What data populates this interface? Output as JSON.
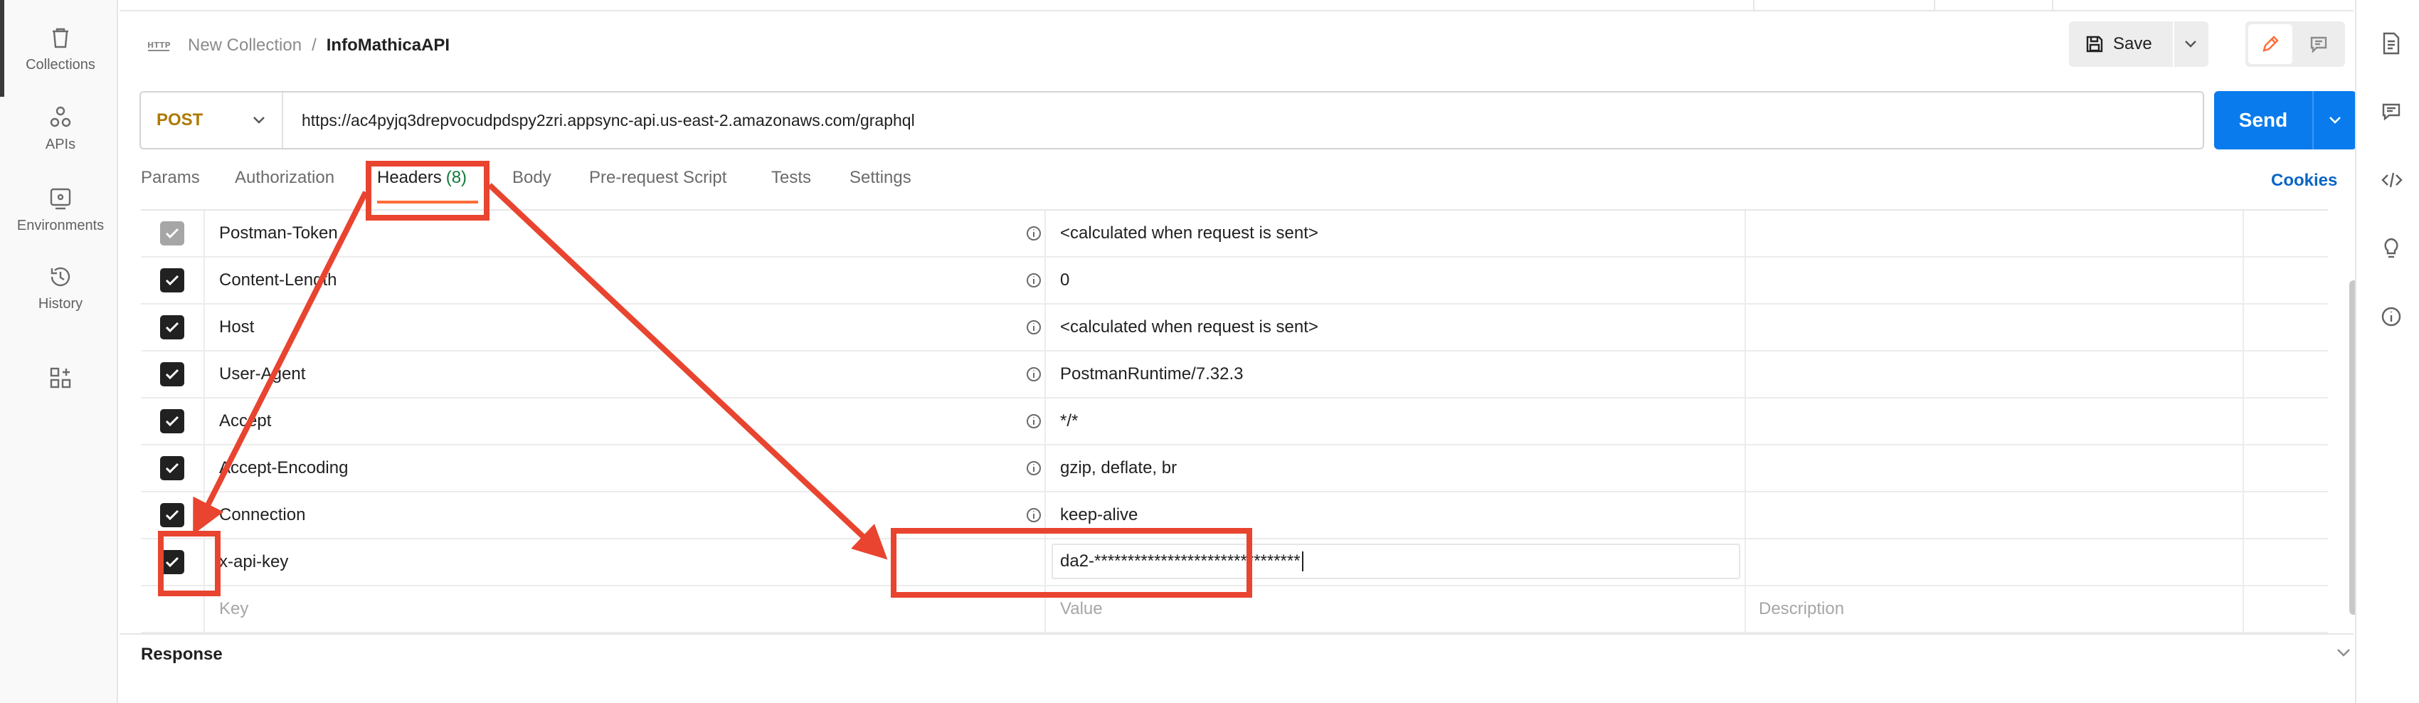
{
  "sidebar": {
    "items": [
      {
        "label": "Collections",
        "icon": "trash-icon"
      },
      {
        "label": "APIs",
        "icon": "apis-icon"
      },
      {
        "label": "Environments",
        "icon": "environments-icon"
      },
      {
        "label": "History",
        "icon": "history-icon"
      },
      {
        "label": "",
        "icon": "add-workspace-icon"
      }
    ]
  },
  "breadcrumb": {
    "icon": "http-icon",
    "collection": "New Collection",
    "separator": "/",
    "request": "InfoMathicaAPI"
  },
  "toolbar": {
    "save_label": "Save"
  },
  "request": {
    "method": "POST",
    "url": "https://ac4pyjq3drepvocudpdspy2zri.appsync-api.us-east-2.amazonaws.com/graphql",
    "send_label": "Send"
  },
  "tabs": [
    {
      "label": "Params"
    },
    {
      "label": "Authorization"
    },
    {
      "label": "Headers",
      "count": "(8)",
      "active": true
    },
    {
      "label": "Body"
    },
    {
      "label": "Pre-request Script"
    },
    {
      "label": "Tests"
    },
    {
      "label": "Settings"
    }
  ],
  "cookies_label": "Cookies",
  "headers": [
    {
      "key": "Postman-Token",
      "value": "<calculated when request is sent>",
      "checked": true,
      "auto": true
    },
    {
      "key": "Content-Length",
      "value": "0",
      "checked": true,
      "auto": true
    },
    {
      "key": "Host",
      "value": "<calculated when request is sent>",
      "checked": true,
      "auto": true
    },
    {
      "key": "User-Agent",
      "value": "PostmanRuntime/7.32.3",
      "checked": true,
      "auto": true
    },
    {
      "key": "Accept",
      "value": "*/*",
      "checked": true,
      "auto": true
    },
    {
      "key": "Accept-Encoding",
      "value": "gzip, deflate, br",
      "checked": true,
      "auto": true
    },
    {
      "key": "Connection",
      "value": "keep-alive",
      "checked": true,
      "auto": true
    },
    {
      "key": "x-api-key",
      "value": "da2-*******************************",
      "checked": true,
      "auto": false
    }
  ],
  "placeholders": {
    "key": "Key",
    "value": "Value",
    "description": "Description"
  },
  "response": {
    "label": "Response"
  },
  "colors": {
    "accent": "#ff6c37",
    "send": "#097bed",
    "annotation": "#e8442f",
    "method": "#ad7a03"
  }
}
